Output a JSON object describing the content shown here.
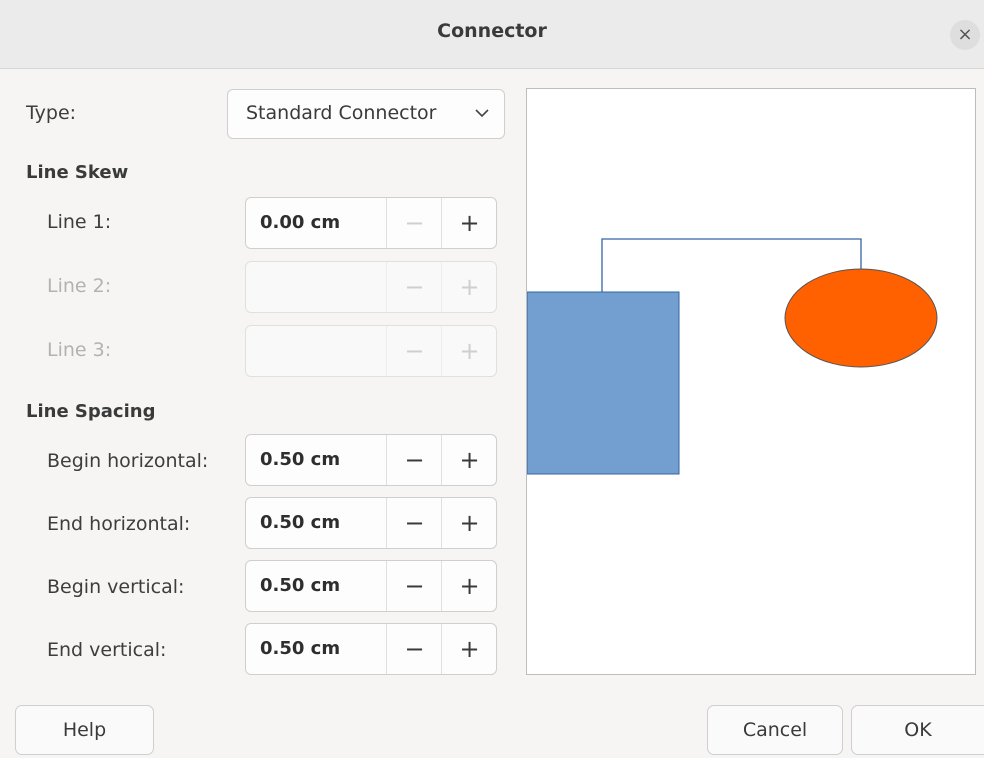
{
  "dialog": {
    "title": "Connector",
    "close_glyph": "×"
  },
  "type": {
    "label": "Type:",
    "value": "Standard Connector"
  },
  "line_skew": {
    "heading": "Line Skew",
    "rows": [
      {
        "label": "Line 1:",
        "value": "0.00 cm",
        "enabled": true
      },
      {
        "label": "Line 2:",
        "value": "",
        "enabled": false
      },
      {
        "label": "Line 3:",
        "value": "",
        "enabled": false
      }
    ]
  },
  "line_spacing": {
    "heading": "Line Spacing",
    "rows": [
      {
        "label": "Begin horizontal:",
        "value": "0.50 cm"
      },
      {
        "label": "End horizontal:",
        "value": "0.50 cm"
      },
      {
        "label": "Begin vertical:",
        "value": "0.50 cm"
      },
      {
        "label": "End vertical:",
        "value": "0.50 cm"
      }
    ]
  },
  "spin_glyphs": {
    "minus": "−",
    "plus": "+"
  },
  "preview": {
    "rect_fill": "#729fcf",
    "ellipse_fill": "#ff6000",
    "connector_color": "#3465a4"
  },
  "buttons": {
    "help": "Help",
    "cancel": "Cancel",
    "ok": "OK"
  }
}
